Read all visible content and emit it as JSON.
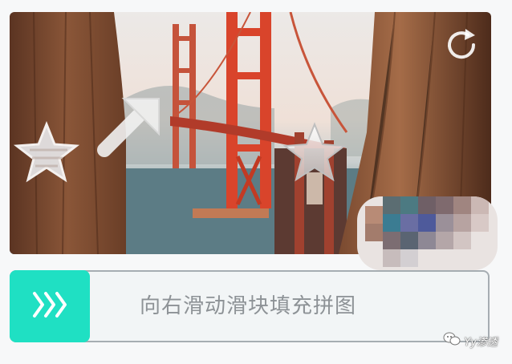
{
  "captcha": {
    "hint_text": "向右滑动滑块填充拼图",
    "refresh_icon": "refresh-icon",
    "handle_icon": "triple-chevron-right-icon",
    "accent_color": "#1fe0c3"
  },
  "watermark": {
    "text": "Yy渗透"
  }
}
